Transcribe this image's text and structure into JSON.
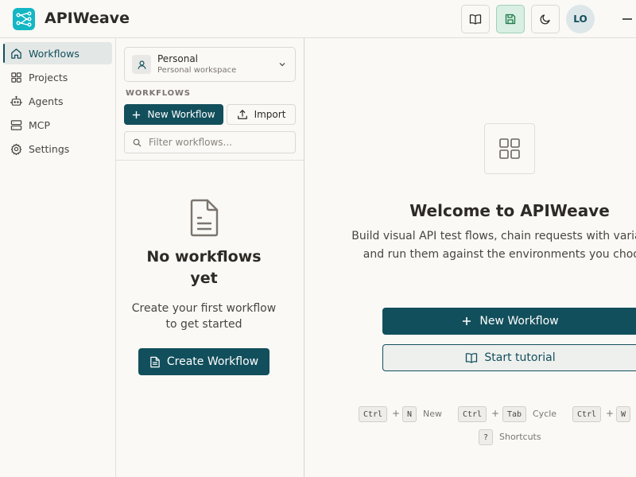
{
  "app": {
    "title": "APIWeave",
    "user_initials": "LO",
    "accent": "#124f5c",
    "logo_color": "#13b7c4"
  },
  "header": {
    "icons": [
      "book-open-icon",
      "save-icon",
      "moon-icon"
    ]
  },
  "sidebar": {
    "items": [
      {
        "label": "Workflows",
        "icon": "home-icon",
        "active": true
      },
      {
        "label": "Projects",
        "icon": "grid-icon",
        "active": false
      },
      {
        "label": "Agents",
        "icon": "robot-icon",
        "active": false
      },
      {
        "label": "MCP",
        "icon": "server-icon",
        "active": false
      },
      {
        "label": "Settings",
        "icon": "gear-icon",
        "active": false
      }
    ]
  },
  "workspace": {
    "name": "Personal",
    "subtitle": "Personal workspace"
  },
  "workflows_panel": {
    "section_label": "WORKFLOWS",
    "new_button": "New Workflow",
    "import_button": "Import",
    "filter_placeholder": "Filter workflows...",
    "empty_title": "No workflows yet",
    "empty_subtitle": "Create your first workflow to get started",
    "create_button": "Create Workflow"
  },
  "main": {
    "title": "Welcome to APIWeave",
    "description": "Build visual API test flows, chain requests with variables, and run them against the environments you choose.",
    "new_button": "New Workflow",
    "tutorial_button": "Start tutorial",
    "shortcuts": {
      "new": {
        "keys": [
          "Ctrl",
          "N"
        ],
        "label": "New"
      },
      "cycle": {
        "keys": [
          "Ctrl",
          "Tab"
        ],
        "label": "Cycle"
      },
      "close": {
        "keys": [
          "Ctrl",
          "W"
        ]
      },
      "help": {
        "keys": [
          "?"
        ],
        "label": "Shortcuts"
      },
      "plus": "+"
    }
  }
}
